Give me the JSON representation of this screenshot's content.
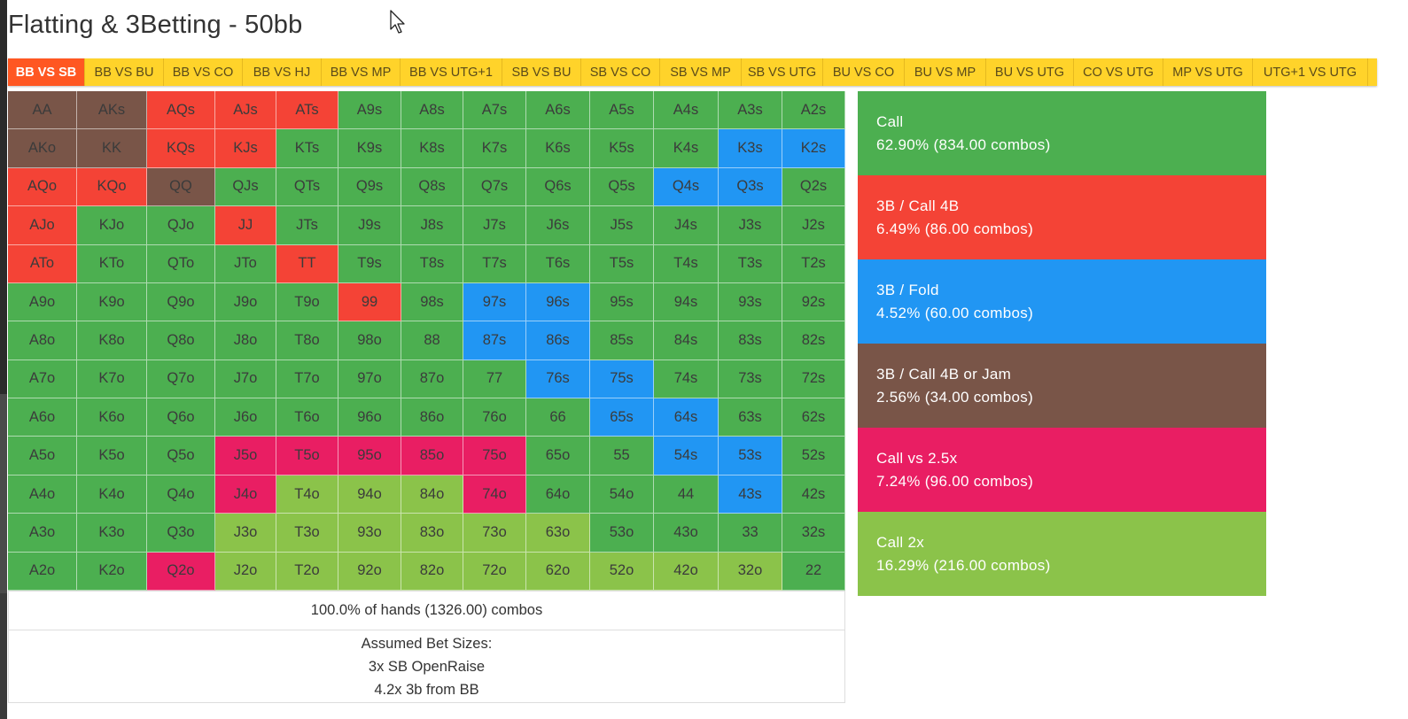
{
  "page": {
    "title": "Flatting & 3Betting - 50bb"
  },
  "tabs": [
    {
      "label": "BB VS SB",
      "active": true
    },
    {
      "label": "BB VS BU"
    },
    {
      "label": "BB VS CO"
    },
    {
      "label": "BB VS HJ"
    },
    {
      "label": "BB VS MP"
    },
    {
      "label": "BB VS UTG+1"
    },
    {
      "label": "SB VS BU"
    },
    {
      "label": "SB VS CO"
    },
    {
      "label": "SB VS MP"
    },
    {
      "label": "SB VS UTG"
    },
    {
      "label": "BU VS CO"
    },
    {
      "label": "BU VS MP"
    },
    {
      "label": "BU VS UTG"
    },
    {
      "label": "CO VS UTG"
    },
    {
      "label": "MP VS UTG"
    },
    {
      "label": "UTG+1 VS UTG"
    }
  ],
  "colors": {
    "call": "#4caf50",
    "three_bet_call_4b": "#f44336",
    "three_bet_fold": "#2196f3",
    "three_bet_call_4b_or_jam": "#795548",
    "call_vs_2_5x": "#e91e63",
    "call_2x": "#8bc34a",
    "tab_bar": "#ffd32a",
    "tab_active": "#ff5722"
  },
  "legend": [
    {
      "key": "G",
      "name": "Call",
      "stat": "62.90% (834.00 combos)",
      "color": "#4caf50"
    },
    {
      "key": "R",
      "name": "3B / Call 4B",
      "stat": "6.49% (86.00 combos)",
      "color": "#f44336"
    },
    {
      "key": "U",
      "name": "3B / Fold",
      "stat": "4.52% (60.00 combos)",
      "color": "#2196f3"
    },
    {
      "key": "B",
      "name": "3B / Call 4B or Jam",
      "stat": "2.56% (34.00 combos)",
      "color": "#795548"
    },
    {
      "key": "P",
      "name": "Call vs 2.5x",
      "stat": "7.24% (96.00 combos)",
      "color": "#e91e63"
    },
    {
      "key": "L",
      "name": "Call 2x",
      "stat": "16.29% (216.00 combos)",
      "color": "#8bc34a"
    }
  ],
  "grid": {
    "hands": [
      [
        "AA",
        "AKs",
        "AQs",
        "AJs",
        "ATs",
        "A9s",
        "A8s",
        "A7s",
        "A6s",
        "A5s",
        "A4s",
        "A3s",
        "A2s"
      ],
      [
        "AKo",
        "KK",
        "KQs",
        "KJs",
        "KTs",
        "K9s",
        "K8s",
        "K7s",
        "K6s",
        "K5s",
        "K4s",
        "K3s",
        "K2s"
      ],
      [
        "AQo",
        "KQo",
        "QQ",
        "QJs",
        "QTs",
        "Q9s",
        "Q8s",
        "Q7s",
        "Q6s",
        "Q5s",
        "Q4s",
        "Q3s",
        "Q2s"
      ],
      [
        "AJo",
        "KJo",
        "QJo",
        "JJ",
        "JTs",
        "J9s",
        "J8s",
        "J7s",
        "J6s",
        "J5s",
        "J4s",
        "J3s",
        "J2s"
      ],
      [
        "ATo",
        "KTo",
        "QTo",
        "JTo",
        "TT",
        "T9s",
        "T8s",
        "T7s",
        "T6s",
        "T5s",
        "T4s",
        "T3s",
        "T2s"
      ],
      [
        "A9o",
        "K9o",
        "Q9o",
        "J9o",
        "T9o",
        "99",
        "98s",
        "97s",
        "96s",
        "95s",
        "94s",
        "93s",
        "92s"
      ],
      [
        "A8o",
        "K8o",
        "Q8o",
        "J8o",
        "T8o",
        "98o",
        "88",
        "87s",
        "86s",
        "85s",
        "84s",
        "83s",
        "82s"
      ],
      [
        "A7o",
        "K7o",
        "Q7o",
        "J7o",
        "T7o",
        "97o",
        "87o",
        "77",
        "76s",
        "75s",
        "74s",
        "73s",
        "72s"
      ],
      [
        "A6o",
        "K6o",
        "Q6o",
        "J6o",
        "T6o",
        "96o",
        "86o",
        "76o",
        "66",
        "65s",
        "64s",
        "63s",
        "62s"
      ],
      [
        "A5o",
        "K5o",
        "Q5o",
        "J5o",
        "T5o",
        "95o",
        "85o",
        "75o",
        "65o",
        "55",
        "54s",
        "53s",
        "52s"
      ],
      [
        "A4o",
        "K4o",
        "Q4o",
        "J4o",
        "T4o",
        "94o",
        "84o",
        "74o",
        "64o",
        "54o",
        "44",
        "43s",
        "42s"
      ],
      [
        "A3o",
        "K3o",
        "Q3o",
        "J3o",
        "T3o",
        "93o",
        "83o",
        "73o",
        "63o",
        "53o",
        "43o",
        "33",
        "32s"
      ],
      [
        "A2o",
        "K2o",
        "Q2o",
        "J2o",
        "T2o",
        "92o",
        "82o",
        "72o",
        "62o",
        "52o",
        "42o",
        "32o",
        "22"
      ]
    ],
    "actions": [
      [
        "B",
        "B",
        "R",
        "R",
        "R",
        "G",
        "G",
        "G",
        "G",
        "G",
        "G",
        "G",
        "G"
      ],
      [
        "B",
        "B",
        "R",
        "R",
        "G",
        "G",
        "G",
        "G",
        "G",
        "G",
        "G",
        "U",
        "U"
      ],
      [
        "R",
        "R",
        "B",
        "G",
        "G",
        "G",
        "G",
        "G",
        "G",
        "G",
        "U",
        "U",
        "G"
      ],
      [
        "R",
        "G",
        "G",
        "R",
        "G",
        "G",
        "G",
        "G",
        "G",
        "G",
        "G",
        "G",
        "G"
      ],
      [
        "R",
        "G",
        "G",
        "G",
        "R",
        "G",
        "G",
        "G",
        "G",
        "G",
        "G",
        "G",
        "G"
      ],
      [
        "G",
        "G",
        "G",
        "G",
        "G",
        "R",
        "G",
        "U",
        "U",
        "G",
        "G",
        "G",
        "G"
      ],
      [
        "G",
        "G",
        "G",
        "G",
        "G",
        "G",
        "G",
        "U",
        "U",
        "G",
        "G",
        "G",
        "G"
      ],
      [
        "G",
        "G",
        "G",
        "G",
        "G",
        "G",
        "G",
        "G",
        "U",
        "U",
        "G",
        "G",
        "G"
      ],
      [
        "G",
        "G",
        "G",
        "G",
        "G",
        "G",
        "G",
        "G",
        "G",
        "U",
        "U",
        "G",
        "G"
      ],
      [
        "G",
        "G",
        "G",
        "P",
        "P",
        "P",
        "P",
        "P",
        "G",
        "G",
        "U",
        "U",
        "G"
      ],
      [
        "G",
        "G",
        "G",
        "P",
        "L",
        "L",
        "L",
        "P",
        "G",
        "G",
        "G",
        "U",
        "G"
      ],
      [
        "G",
        "G",
        "G",
        "L",
        "L",
        "L",
        "L",
        "L",
        "L",
        "G",
        "G",
        "G",
        "G"
      ],
      [
        "G",
        "G",
        "P",
        "L",
        "L",
        "L",
        "L",
        "L",
        "L",
        "L",
        "L",
        "L",
        "G"
      ]
    ]
  },
  "summary": {
    "total": "100.0% of hands (1326.00) combos",
    "bet_sizes_title": "Assumed Bet Sizes:",
    "bet_sizes_line1": "3x SB OpenRaise",
    "bet_sizes_line2": "4.2x 3b from BB"
  }
}
